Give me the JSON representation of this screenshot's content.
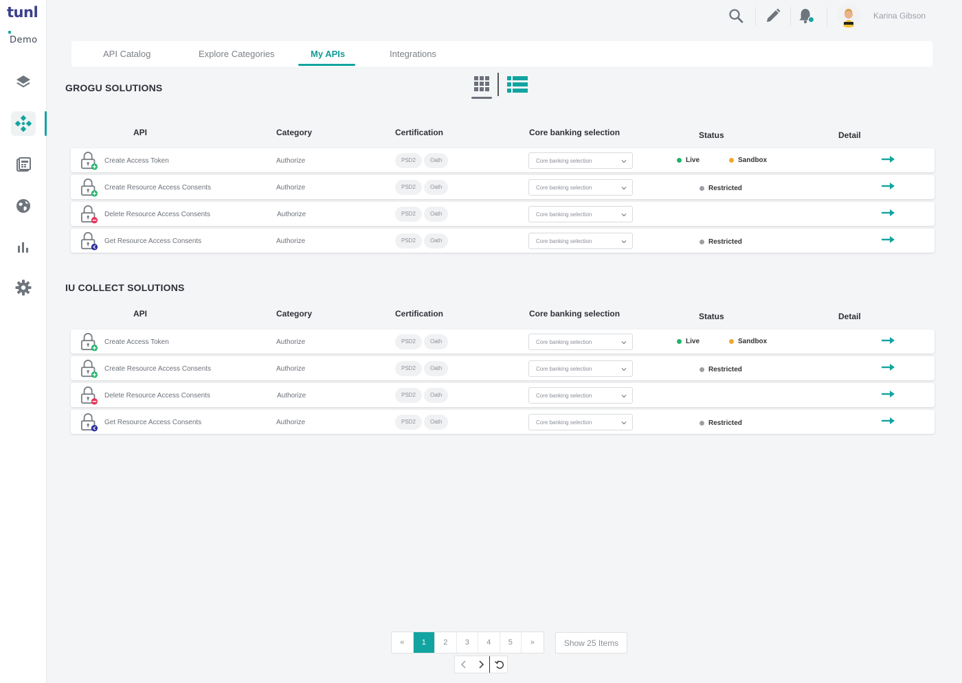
{
  "app": {
    "logo_main": "tunl",
    "logo_dot": ".",
    "logo_sub": "Demo"
  },
  "sidebar": {
    "items": [
      {
        "icon": "layers-icon"
      },
      {
        "icon": "api-nodes-icon",
        "active": true
      },
      {
        "icon": "calculator-grid-icon"
      },
      {
        "icon": "globe-icon"
      },
      {
        "icon": "bar-chart-icon"
      },
      {
        "icon": "gear-icon"
      }
    ]
  },
  "topbar": {
    "icons": [
      "search-icon",
      "pencil-icon",
      "bell-icon"
    ],
    "user_name": "Karina Gibson"
  },
  "tabs": [
    {
      "label": "API Catalog"
    },
    {
      "label": "Explore Categories"
    },
    {
      "label": "My APIs",
      "active": true
    },
    {
      "label": "Integrations"
    }
  ],
  "columns": {
    "api": "API",
    "category": "Category",
    "certification": "Certification",
    "core_banking": "Core banking selection",
    "status": "Status",
    "detail": "Detail"
  },
  "sections": [
    {
      "title": "GROGU SOLUTIONS",
      "rows": [
        {
          "name": "Create Access Token",
          "category": "Authorize",
          "cert1": "PSD2",
          "cert2": "Oath",
          "select": "Core banking selection",
          "status_live": "Live",
          "status_sandbox": "Sandbox",
          "badge": "plus"
        },
        {
          "name": "Create Resource Access Consents",
          "category": "Authorize",
          "cert1": "PSD2",
          "cert2": "Oath",
          "select": "Core banking selection",
          "status_restricted": "Restricted",
          "badge": "plus"
        },
        {
          "name": "Delete Resource Access Consents",
          "category": "Authorize",
          "cert1": "PSD2",
          "cert2": "Oath",
          "select": "Core banking selection",
          "badge": "minus"
        },
        {
          "name": "Get Resource Access Consents",
          "category": "Authorize",
          "cert1": "PSD2",
          "cert2": "Oath",
          "select": "Core banking selection",
          "status_restricted": "Restricted",
          "badge": "get"
        }
      ]
    },
    {
      "title": "IU COLLECT SOLUTIONS",
      "rows": [
        {
          "name": "Create Access Token",
          "category": "Authorize",
          "cert1": "PSD2",
          "cert2": "Oath",
          "select": "Core banking selection",
          "status_live": "Live",
          "status_sandbox": "Sandbox",
          "badge": "plus"
        },
        {
          "name": "Create Resource Access Consents",
          "category": "Authorize",
          "cert1": "PSD2",
          "cert2": "Oath",
          "select": "Core banking selection",
          "status_restricted": "Restricted",
          "badge": "plus"
        },
        {
          "name": "Delete Resource Access Consents",
          "category": "Authorize",
          "cert1": "PSD2",
          "cert2": "Oath",
          "select": "Core banking selection",
          "badge": "minus"
        },
        {
          "name": "Get Resource Access Consents",
          "category": "Authorize",
          "cert1": "PSD2",
          "cert2": "Oath",
          "select": "Core banking selection",
          "status_restricted": "Restricted",
          "badge": "get"
        }
      ]
    }
  ],
  "pagination": {
    "first": "«",
    "pages": [
      "1",
      "2",
      "3",
      "4",
      "5"
    ],
    "current": "1",
    "last": "»",
    "show_items": "Show 25 Items"
  },
  "colors": {
    "accent": "#12a4a0",
    "live": "#1fb36a",
    "sandbox": "#f2a72d",
    "restricted": "#9b9fa4",
    "badge_plus": "#1fb36a",
    "badge_minus": "#e8345a",
    "badge_get": "#2a2a9a"
  }
}
